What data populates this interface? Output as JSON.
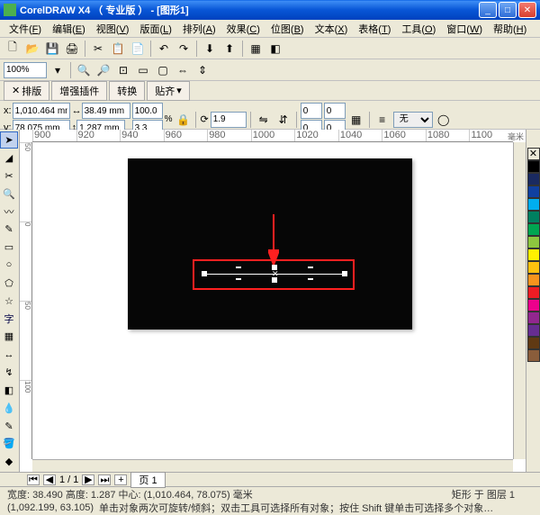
{
  "title": "CorelDRAW X4 （ 专业版 ） - [图形1]",
  "menus": [
    {
      "label": "文件",
      "key": "F"
    },
    {
      "label": "编辑",
      "key": "E"
    },
    {
      "label": "视图",
      "key": "V"
    },
    {
      "label": "版面",
      "key": "L"
    },
    {
      "label": "排列",
      "key": "A"
    },
    {
      "label": "效果",
      "key": "C"
    },
    {
      "label": "位图",
      "key": "B"
    },
    {
      "label": "文本",
      "key": "X"
    },
    {
      "label": "表格",
      "key": "T"
    },
    {
      "label": "工具",
      "key": "O"
    },
    {
      "label": "窗口",
      "key": "W"
    },
    {
      "label": "帮助",
      "key": "H"
    }
  ],
  "zoom": "100%",
  "tabs": [
    {
      "label": "排版",
      "icon": "✕"
    },
    {
      "label": "增强插件",
      "icon": ""
    },
    {
      "label": "转换",
      "icon": ""
    },
    {
      "label": "贴齐",
      "icon": "▾"
    }
  ],
  "property": {
    "x_label": "x:",
    "x_value": "1,010.464 mm",
    "y_label": "y:",
    "y_value": "78.075 mm",
    "w_value": "38.49 mm",
    "h_value": "1.287 mm",
    "scale_w": "100.0",
    "scale_h": "3.3",
    "rotation": "1.9",
    "none_label": "无"
  },
  "ruler_h": [
    "900",
    "920",
    "940",
    "960",
    "980",
    "1000",
    "1020",
    "1040",
    "1060",
    "1080",
    "1100"
  ],
  "ruler_h_unit": "毫米",
  "ruler_v": [
    "50",
    "0",
    "50",
    "100"
  ],
  "toolbox": [
    "pick",
    "shape",
    "crop",
    "zoom",
    "freehand",
    "smart",
    "rect",
    "ellipse",
    "polygon",
    "basic",
    "text",
    "table",
    "dimension",
    "connector",
    "interactive",
    "eyedrop",
    "outline",
    "fill",
    "ifill"
  ],
  "palette": [
    "#ffffff",
    "#000000",
    "#1a2a60",
    "#1040a0",
    "#00aeef",
    "#008060",
    "#00a651",
    "#8dc63f",
    "#fff200",
    "#ffc20e",
    "#f7941d",
    "#ed1c24",
    "#ec008c",
    "#92278f",
    "#662d91",
    "#603913",
    "#8a5d3b"
  ],
  "page": {
    "count": "1 / 1",
    "tab": "页 1"
  },
  "status": {
    "dims": "宽度: 38.490 高度: 1.287 中心: (1,010.464, 78.075) 毫米",
    "object": "矩形 于 图层 1",
    "coords": "(1,092.199, 63.105)",
    "hint": "单击对象两次可旋转/倾斜；双击工具可选择所有对象；按住 Shift 键单击可选择多个对象…"
  }
}
